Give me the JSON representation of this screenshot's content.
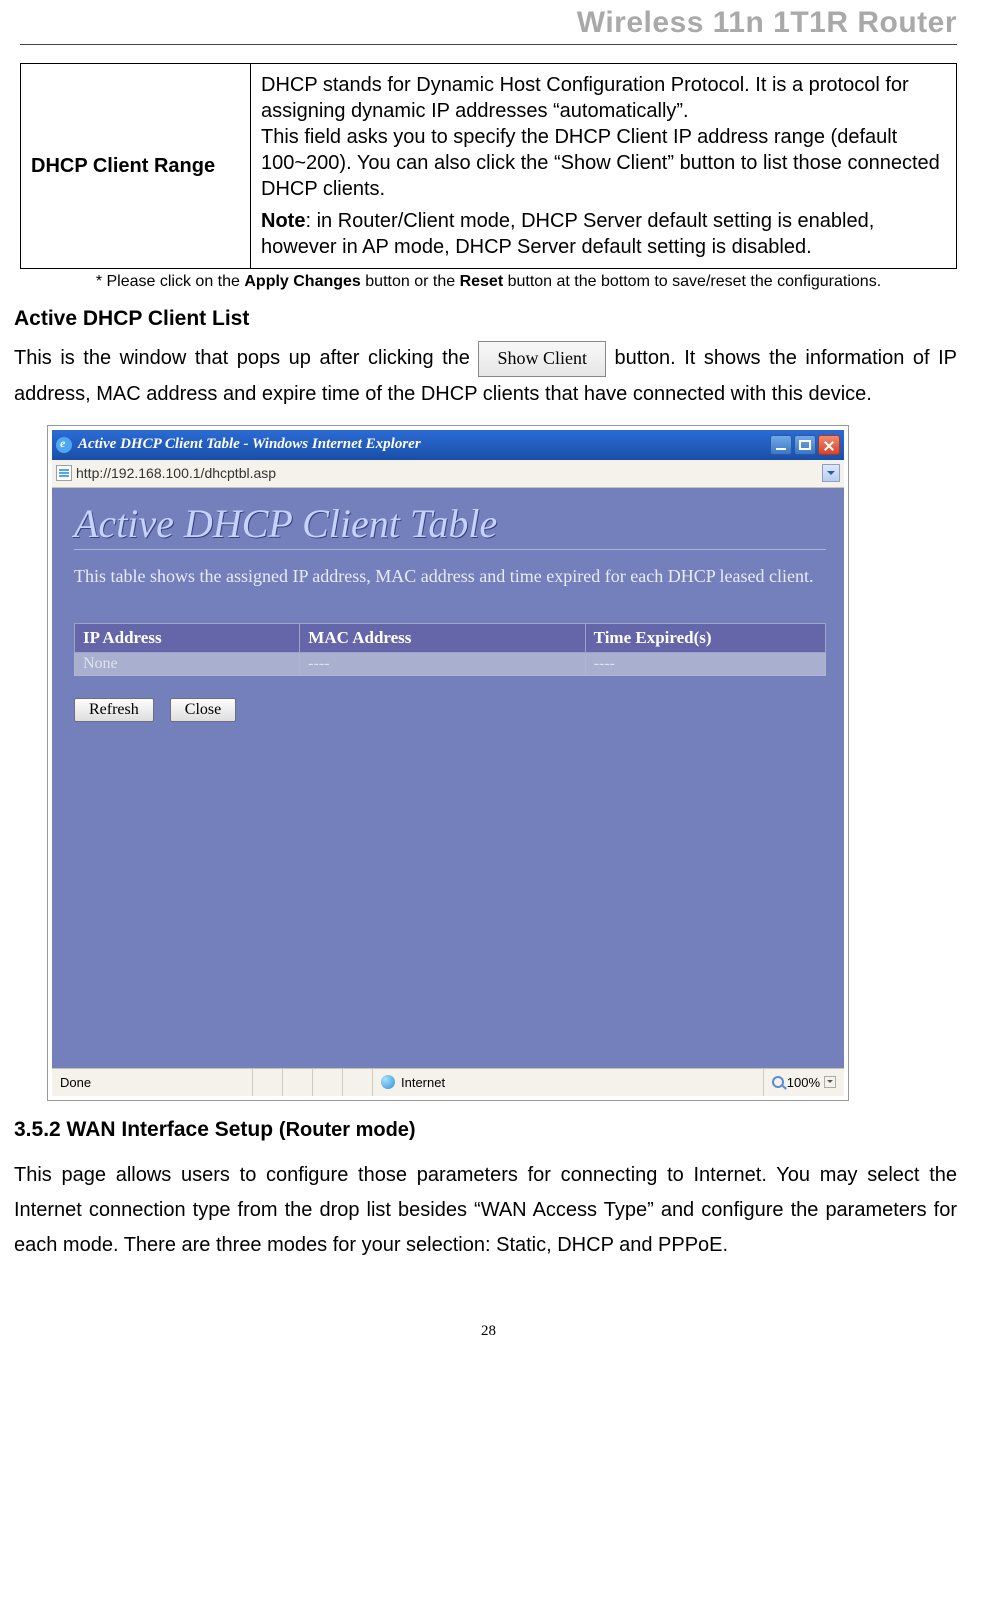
{
  "header_title": "Wireless 11n 1T1R Router",
  "table": {
    "left": "DHCP Client Range",
    "right_p1": "DHCP stands for Dynamic Host Configuration Protocol. It is a protocol for assigning dynamic IP addresses “automatically”.",
    "right_p2": "This field asks you to specify the DHCP Client IP address range (default 100~200). You can also click the “Show Client” button to list those connected DHCP clients.",
    "note_label": "Note",
    "note_text": ": in Router/Client mode, DHCP Server default setting is enabled, however in AP mode, DHCP Server default setting is disabled."
  },
  "footnote": {
    "pre": "* Please click on the ",
    "b1": "Apply Changes",
    "mid": " button or the ",
    "b2": "Reset",
    "post": " button at the bottom to save/reset the configurations."
  },
  "sub1": "Active DHCP Client List",
  "para1_a": "This is the window that pops up after clicking the ",
  "show_client_btn": "Show Client",
  "para1_b": " button. It shows the information of IP address, MAC address and expire time of the DHCP clients that have connected with this device.",
  "browser": {
    "title": "Active DHCP Client Table - Windows Internet Explorer",
    "url": "http://192.168.100.1/dhcptbl.asp",
    "heading": "Active DHCP Client Table",
    "desc": "This table shows the assigned IP address, MAC address and time expired for each DHCP leased client.",
    "cols": [
      "IP Address",
      "MAC Address",
      "Time Expired(s)"
    ],
    "row": [
      "None",
      "----",
      "----"
    ],
    "btn_refresh": "Refresh",
    "btn_close": "Close",
    "status_done": "Done",
    "status_zone": "Internet",
    "status_zoom": "100%"
  },
  "sec2_prefix": "3.5.2 WAN Interface Setup ",
  "sec2_suffix": "(Router mode)",
  "para2": "This page allows users to configure those parameters for connecting to Internet. You may select the Internet connection type from the drop list besides “WAN Access Type” and configure the parameters for each mode. There are three modes for your selection: Static, DHCP and PPPoE.",
  "page_num": "28"
}
